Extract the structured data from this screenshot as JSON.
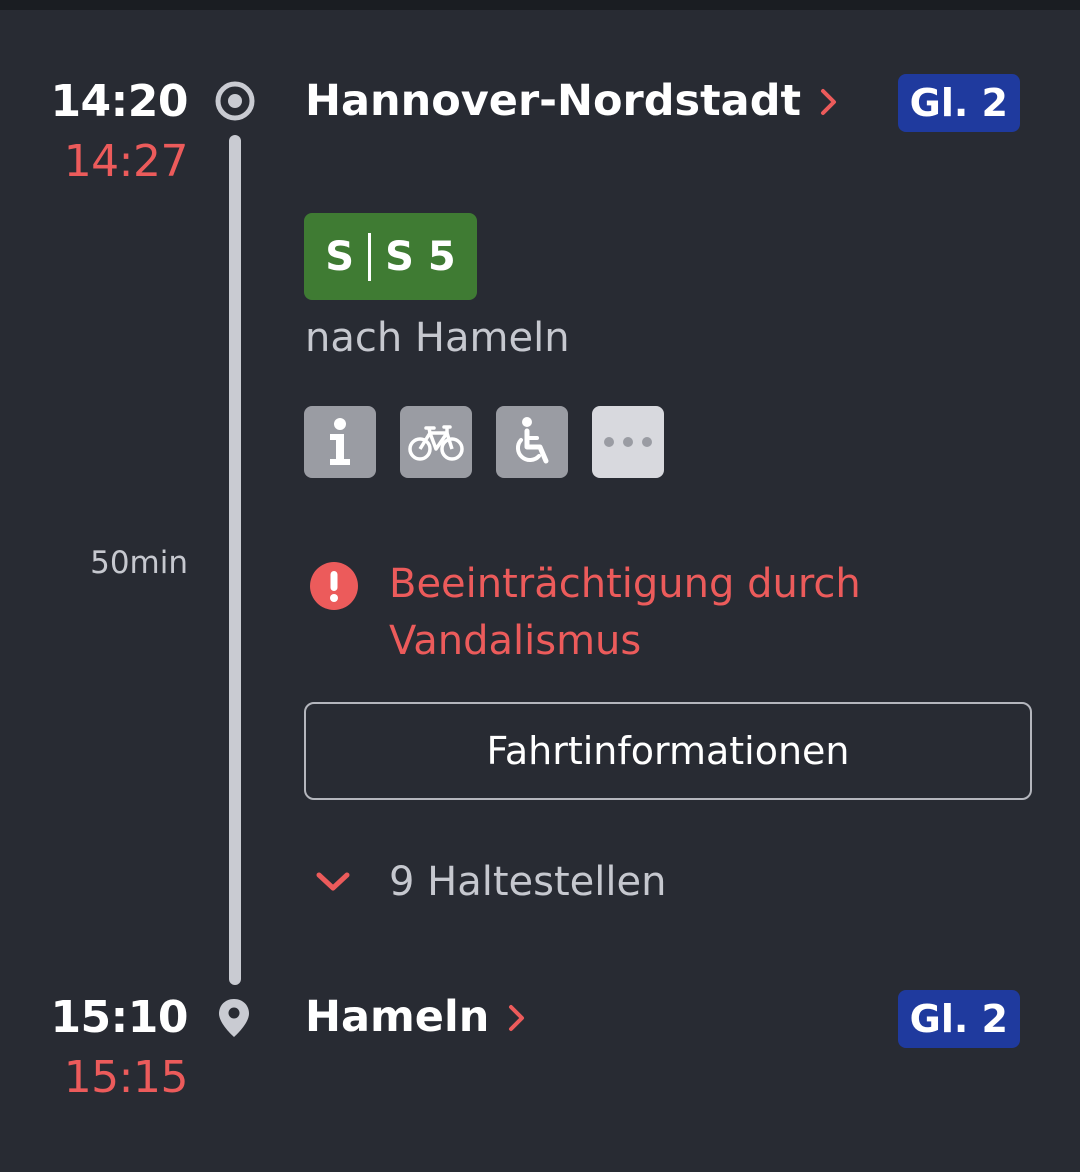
{
  "origin": {
    "time_planned": "14:20",
    "time_actual": "14:27",
    "station": "Hannover-Nordstadt",
    "platform": "Gl. 2"
  },
  "journey": {
    "duration": "50min",
    "product": "S",
    "line": "S 5",
    "direction": "nach Hameln",
    "icons": [
      "info-icon",
      "bicycle-icon",
      "wheelchair-icon",
      "more-icon"
    ],
    "alert": "Beeinträchtigung durch Vandalismus",
    "details_button": "Fahrtinformationen",
    "stops_toggle": "9 Haltestellen"
  },
  "destination": {
    "time_planned": "15:10",
    "time_actual": "15:15",
    "station": "Hameln",
    "platform": "Gl. 2"
  },
  "colors": {
    "background": "#282b33",
    "delay": "#ec5b5b",
    "sbahn_green": "#3f7b33",
    "platform_blue": "#1f3a9e"
  }
}
